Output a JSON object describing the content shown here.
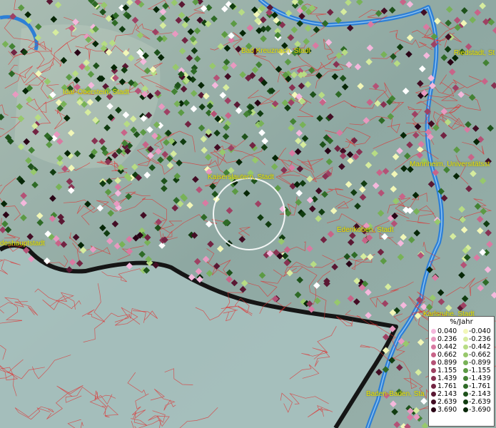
{
  "map": {
    "cities": [
      {
        "id": "bad-kreuznach",
        "label": "Bad Kreuznach, Stadt"
      },
      {
        "id": "riedstadt",
        "label": "Riedstadt, St"
      },
      {
        "id": "idar-oberstein",
        "label": "Idar-Oberstein, Stadt"
      },
      {
        "id": "kaiserslautern",
        "label": "Kaiserslautern, Stadt"
      },
      {
        "id": "mannheim",
        "label": "Mannheim, Universitätsst"
      },
      {
        "id": "edenkoben",
        "label": "Edenkoben, Stadt"
      },
      {
        "id": "landeshauptstadt",
        "label": "deshauptstadt"
      },
      {
        "id": "karlsruhe",
        "label": "Karlsruhe, Stadt"
      },
      {
        "id": "baden-baden",
        "label": "Baden-Baden, Sta"
      }
    ],
    "colors": {
      "background": "#8fa9a4",
      "boundary": "#e03030",
      "river": "#2d7fd6",
      "label": "#e8e200"
    }
  },
  "legend": {
    "title": "%/Jahr",
    "positive": [
      {
        "label": "0.040",
        "color": "#f4b8dc"
      },
      {
        "label": "0.236",
        "color": "#e899c0"
      },
      {
        "label": "0.442",
        "color": "#d97aa2"
      },
      {
        "label": "0.662",
        "color": "#c86488"
      },
      {
        "label": "0.899",
        "color": "#b45276"
      },
      {
        "label": "1.155",
        "color": "#9e4163"
      },
      {
        "label": "1.439",
        "color": "#883252"
      },
      {
        "label": "1.761",
        "color": "#722442"
      },
      {
        "label": "2.143",
        "color": "#5a1833"
      },
      {
        "label": "2.639",
        "color": "#420d24"
      },
      {
        "label": "3.690",
        "color": "#2a0416"
      }
    ],
    "negative": [
      {
        "label": "-0.040",
        "color": "#f2f7b8"
      },
      {
        "label": "-0.236",
        "color": "#d6ec9e"
      },
      {
        "label": "-0.442",
        "color": "#b7dc84"
      },
      {
        "label": "-0.662",
        "color": "#97c86c"
      },
      {
        "label": "-0.899",
        "color": "#78b257"
      },
      {
        "label": "-1.155",
        "color": "#5c9a44"
      },
      {
        "label": "-1.439",
        "color": "#438234"
      },
      {
        "label": "-1.761",
        "color": "#2e6a26"
      },
      {
        "label": "-2.143",
        "color": "#1e521b"
      },
      {
        "label": "-2.639",
        "color": "#113c10"
      },
      {
        "label": "-3.690",
        "color": "#062606"
      }
    ]
  }
}
